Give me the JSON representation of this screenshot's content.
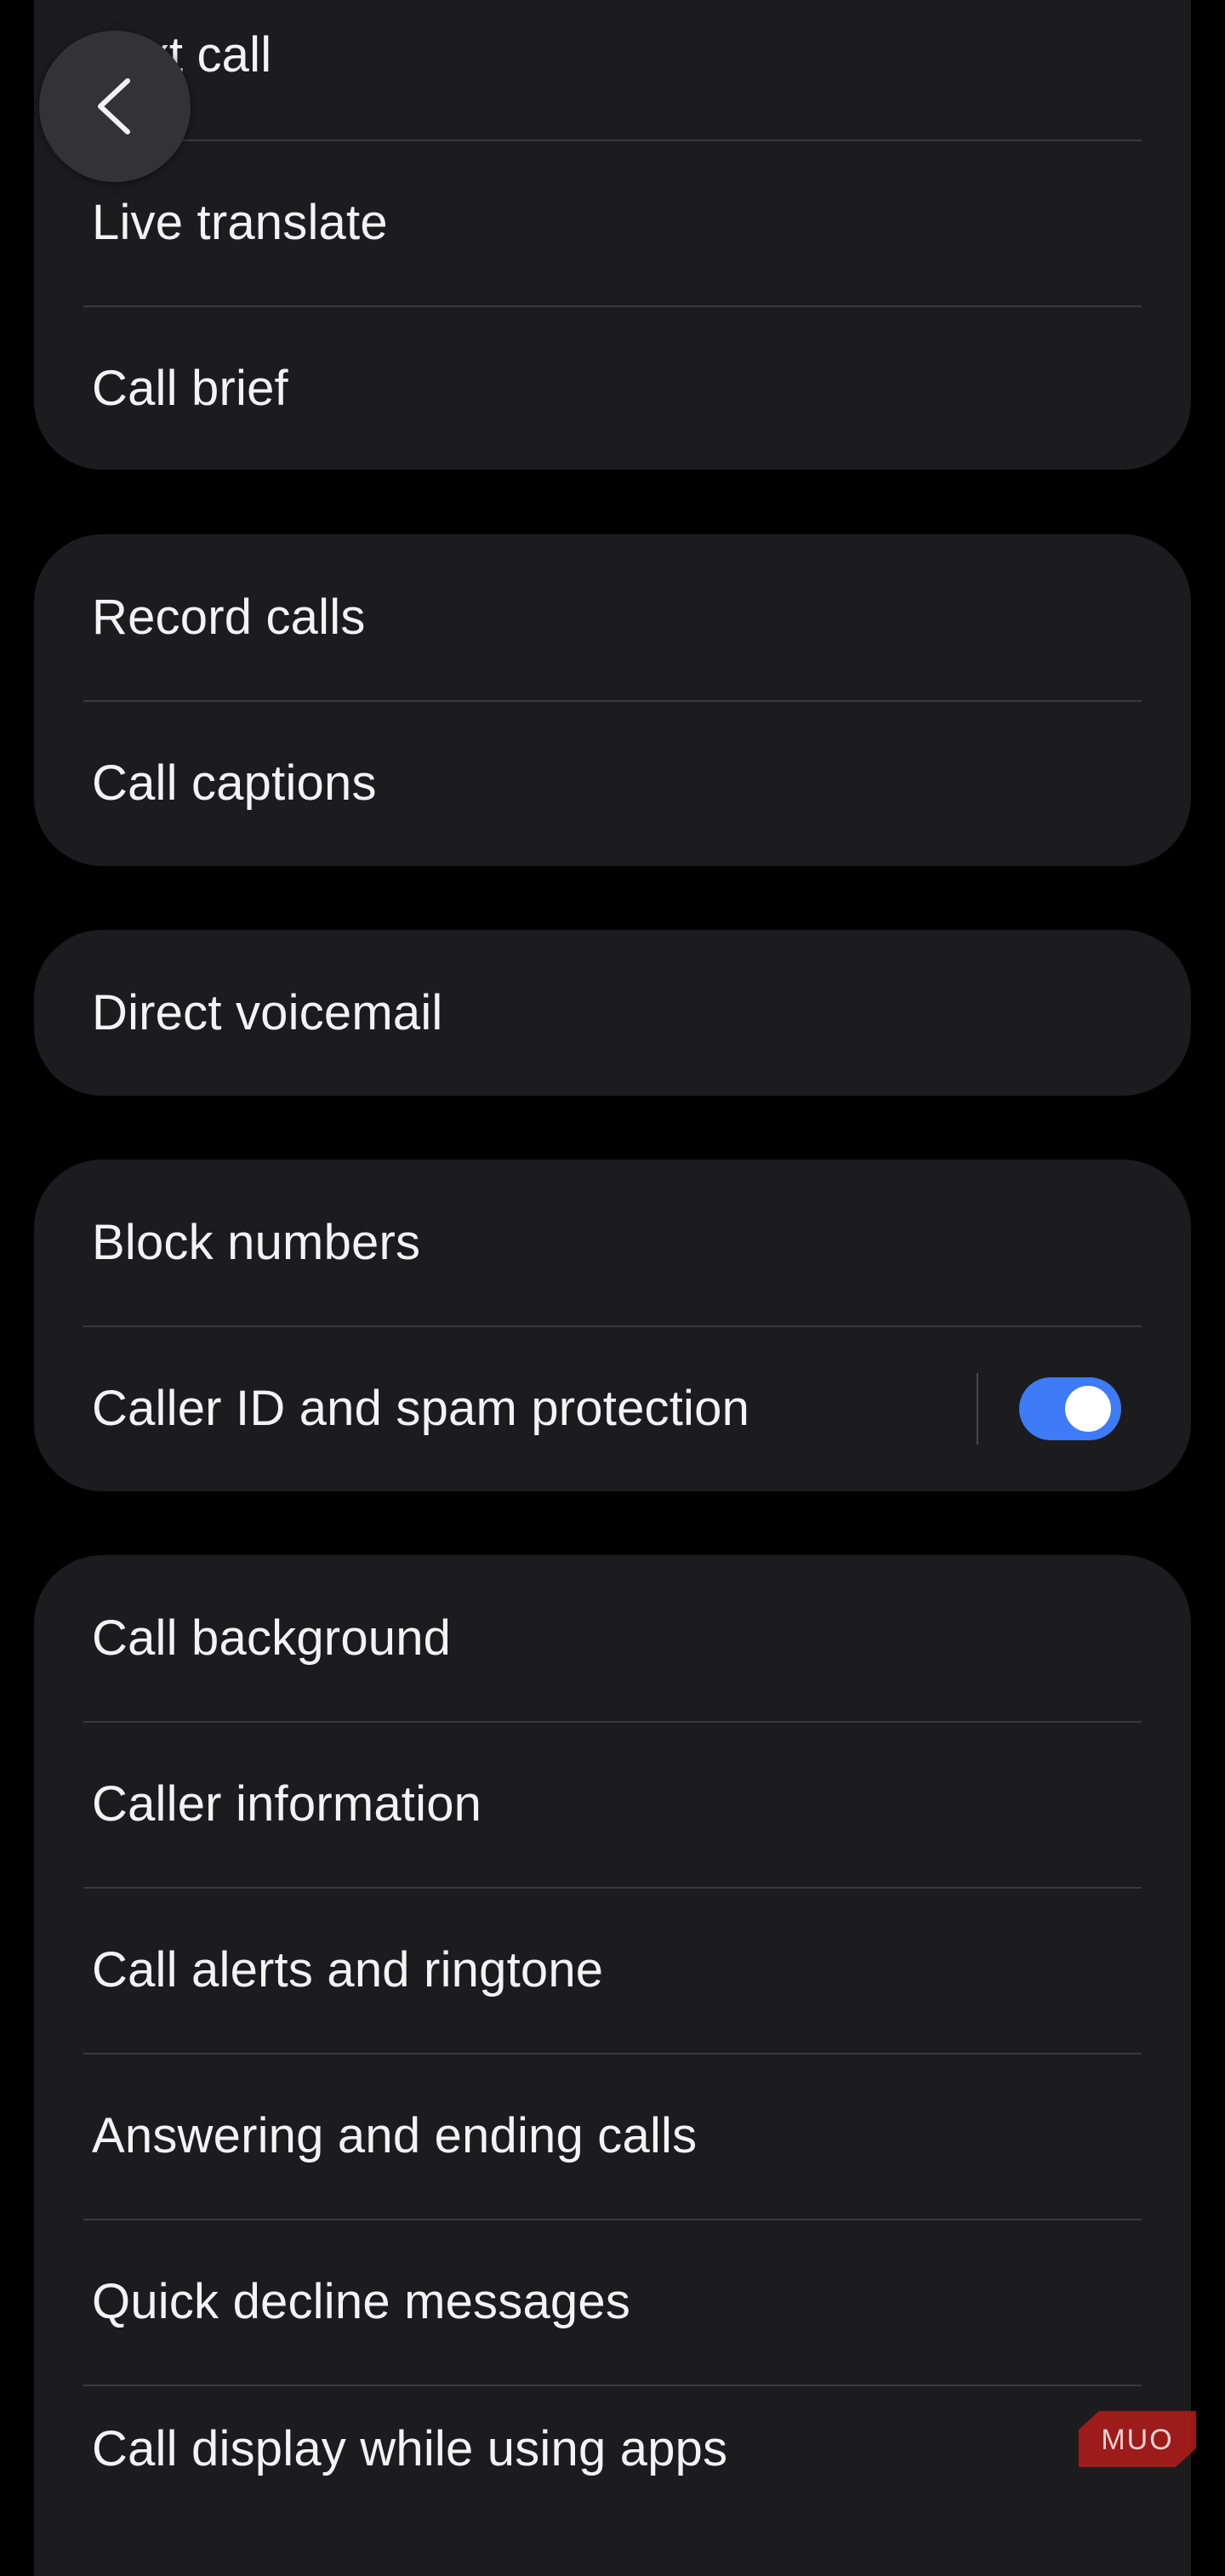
{
  "back_button": {
    "icon": "chevron-left-icon"
  },
  "group1": {
    "items": [
      {
        "label": "Text call"
      },
      {
        "label": "Live translate"
      },
      {
        "label": "Call brief"
      }
    ]
  },
  "group2": {
    "items": [
      {
        "label": "Record calls"
      },
      {
        "label": "Call captions"
      }
    ]
  },
  "group3": {
    "items": [
      {
        "label": "Direct voicemail"
      }
    ]
  },
  "group4": {
    "items": [
      {
        "label": "Block numbers"
      },
      {
        "label": "Caller ID and spam protection",
        "toggle_on": true
      }
    ]
  },
  "group5": {
    "items": [
      {
        "label": "Call background"
      },
      {
        "label": "Caller information"
      },
      {
        "label": "Call alerts and ringtone"
      },
      {
        "label": "Answering and ending calls"
      },
      {
        "label": "Quick decline messages"
      },
      {
        "label": "Call display while using apps"
      }
    ]
  },
  "watermark": {
    "text": "MUO",
    "color": "#b31b1b"
  },
  "colors": {
    "background": "#000000",
    "card": "#1c1c1e",
    "divider": "#3a3a3d",
    "toggle_on": "#3e7bf6",
    "text": "#f3f3f3"
  }
}
